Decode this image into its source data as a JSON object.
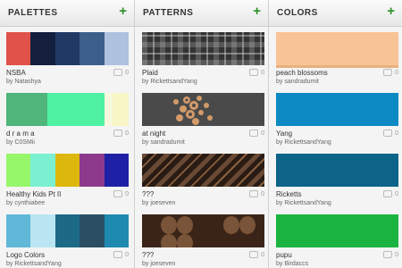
{
  "columns": {
    "palettes": {
      "title": "PALETTES",
      "items": [
        {
          "title": "NSBA",
          "author": "by Natashya",
          "comments": "0",
          "colors": [
            "#e0524a",
            "#131f3d",
            "#203a64",
            "#3b5f8a",
            "#aec1de"
          ]
        },
        {
          "title": "d r a m a",
          "author": "by C0SMii",
          "comments": "0",
          "colors": [
            "#4fb57a",
            "#4fb57a",
            "#4ff2a3",
            "#4ff2a3",
            "#4ff2a3",
            "#f8f8de",
            "#f8f6c6"
          ]
        },
        {
          "title": "Healthy Kids Pt II",
          "author": "by cynthiabee",
          "comments": "0",
          "colors": [
            "#96f76a",
            "#7af0d1",
            "#ddb70b",
            "#8d3a8d",
            "#1e21a5"
          ]
        },
        {
          "title": "Logo Colors",
          "author": "by RickettsandYang",
          "comments": "0",
          "colors": [
            "#5fb8d8",
            "#b9e6f2",
            "#1c6a86",
            "#2a4f63",
            "#1e8ab0"
          ]
        }
      ]
    },
    "patterns": {
      "title": "PATTERNS",
      "items": [
        {
          "title": "Plaid",
          "author": "by RickettsandYang",
          "comments": "0",
          "pattern": "plaid"
        },
        {
          "title": "at night",
          "author": "by sandradumit",
          "comments": "0",
          "pattern": "night"
        },
        {
          "title": "???",
          "author": "by joeseven",
          "comments": "0",
          "pattern": "q1"
        },
        {
          "title": "???",
          "author": "by joeseven",
          "comments": "0",
          "pattern": "q2"
        }
      ]
    },
    "colors": {
      "title": "COLORS",
      "items": [
        {
          "title": "peach blossoms",
          "author": "by sandradumit",
          "comments": "0",
          "color": "#f8c496"
        },
        {
          "title": "Yang",
          "author": "by RickettsandYang",
          "comments": "0",
          "color": "#0d8ac3"
        },
        {
          "title": "Ricketts",
          "author": "by RickettsandYang",
          "comments": "0",
          "color": "#0c6488"
        },
        {
          "title": "pupu",
          "author": "by Birdaccs",
          "comments": "0",
          "color": "#1bb440"
        }
      ]
    }
  },
  "add_icon": "plus-icon",
  "comment_icon": "comment-bubble-icon"
}
